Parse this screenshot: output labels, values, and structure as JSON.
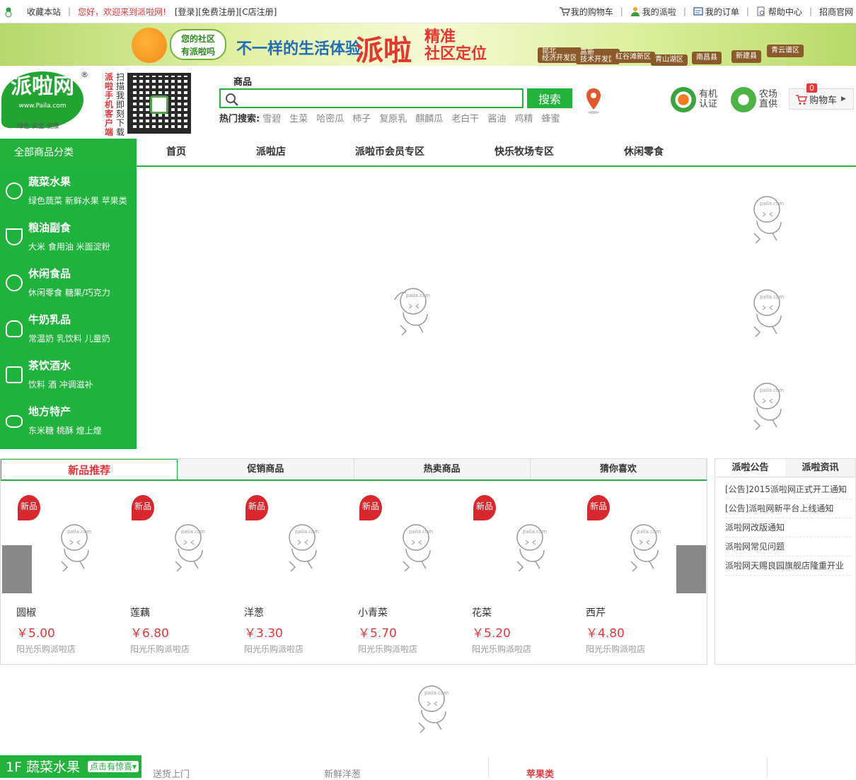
{
  "topbar": {
    "left": [
      "收藏本站",
      "您好，欢迎来到派啦网!",
      "[登录]",
      "[免费注册]",
      "[C店注册]"
    ],
    "right": [
      {
        "icon": "cart-icon",
        "label": "我的购物车"
      },
      {
        "icon": "user-icon",
        "label": "我的派啦"
      },
      {
        "icon": "order-icon",
        "label": "我的订单"
      },
      {
        "icon": "help-icon",
        "label": "帮助中心"
      },
      {
        "icon": "",
        "label": "招商官网"
      }
    ]
  },
  "banner": {
    "bubble": "您的社区\n有派啦吗",
    "slogan": "不一样的生活体验",
    "brand": "派啦",
    "brand2a": "精准",
    "brand2b": "社区定位",
    "signs": [
      "昆北\n经济开发区",
      "高新\n技术开发区",
      "红谷滩新区",
      "青山湖区",
      "南昌县",
      "新建县",
      "青云谱区"
    ]
  },
  "header": {
    "logo": "派啦网",
    "logo_url": "www.Paila.com",
    "logo_tag": "绿色 安全 健康",
    "registered": "®",
    "mobile_text": "派啦手机客户端",
    "scan_text": "扫描我即刻下载",
    "search_tab": "商品",
    "search_placeholder": "",
    "search_button": "搜索",
    "hot_label": "热门搜索:",
    "hot_terms": [
      "雪碧",
      "生菜",
      "哈密瓜",
      "柿子",
      "复原乳",
      "麒麟瓜",
      "老白干",
      "酱油",
      "鸡精",
      "蜂蜜"
    ],
    "badge1": "有机认证",
    "badge2": "农场直供",
    "cart_label": "购物车",
    "cart_count": "0"
  },
  "nav": {
    "all_categories": "全部商品分类",
    "items": [
      "首页",
      "派啦店",
      "派啦币会员专区",
      "快乐牧场专区",
      "休闲零食"
    ]
  },
  "categories": [
    {
      "title": "蔬菜水果",
      "sub": "绿色蔬菜 新鲜水果 苹果类"
    },
    {
      "title": "粮油副食",
      "sub": "大米 食用油 米面淀粉"
    },
    {
      "title": "休闲食品",
      "sub": "休闲零食 糖果/巧克力"
    },
    {
      "title": "牛奶乳品",
      "sub": "常温奶 乳饮料 儿童奶"
    },
    {
      "title": "茶饮酒水",
      "sub": "饮料 酒 冲调滋补"
    },
    {
      "title": "地方特产",
      "sub": "东米糖 桃酥 煌上煌"
    }
  ],
  "product_tabs": [
    "新品推荐",
    "促销商品",
    "热卖商品",
    "猜你喜欢"
  ],
  "new_tag": "新品",
  "products": [
    {
      "name": "圆椒",
      "price": "￥5.00",
      "store": "阳光乐购派啦店"
    },
    {
      "name": "莲藕",
      "price": "￥6.80",
      "store": "阳光乐购派啦店"
    },
    {
      "name": "洋葱",
      "price": "￥3.30",
      "store": "阳光乐购派啦店"
    },
    {
      "name": "小青菜",
      "price": "￥5.70",
      "store": "阳光乐购派啦店"
    },
    {
      "name": "花菜",
      "price": "￥5.20",
      "store": "阳光乐购派啦店"
    },
    {
      "name": "西芹",
      "price": "￥4.80",
      "store": "阳光乐购派啦店"
    }
  ],
  "news_tabs": [
    "派啦公告",
    "派啦资讯"
  ],
  "news": [
    "[公告]2015派啦网正式开工通知",
    "[公告]派啦网新平台上线通知",
    "派啦网改版通知",
    "派啦网常见问题",
    "派啦网天赐良园旗舰店隆重开业"
  ],
  "floor": {
    "title": "1F 蔬菜水果",
    "tag": "点击有惊喜▾",
    "cells": [
      "送货上门",
      "新鲜洋葱",
      "苹果类"
    ]
  },
  "placeholder_label": "paila.com",
  "colors": {
    "green": "#23b23c",
    "red": "#e4393c"
  }
}
